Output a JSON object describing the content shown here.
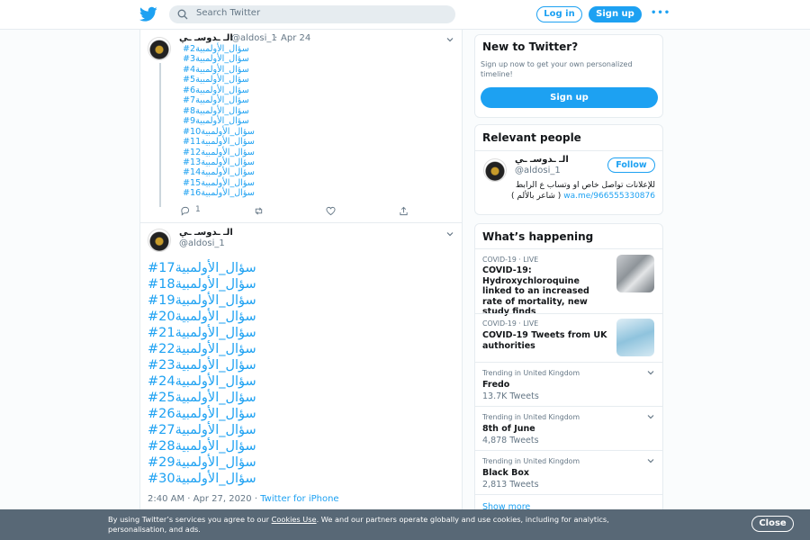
{
  "header": {
    "search_placeholder": "Search Twitter",
    "login_label": "Log in",
    "signup_label": "Sign up",
    "more_label": "•••",
    "brand_color": "#1da1f2"
  },
  "tweet1": {
    "name": "الـ ـدوسـ ـي",
    "handle": "@aldosi_1",
    "separator": "·",
    "date": "Apr 24",
    "lines": [
      "#سؤال_الأولمبية2",
      "#سؤال_الأولمبية3",
      "#سؤال_الأولمبية4",
      "#سؤال_الأولمبية5",
      "#سؤال_الأولمبية6",
      "#سؤال_الأولمبية7",
      "#سؤال_الأولمبية8",
      "#سؤال_الأولمبية9",
      "#سؤال_الأولمبية10",
      "#سؤال_الأولمبية11",
      "#سؤال_الأولمبية12",
      "#سؤال_الأولمبية13",
      "#سؤال_الأولمبية14",
      "#سؤال_الأولمبية15",
      "#سؤال_الأولمبية16"
    ],
    "reply_count": "1"
  },
  "tweet2": {
    "name": "الـ ـدوسـ ـي",
    "handle": "@aldosi_1",
    "lines": [
      "#سؤال_الأولمبية17",
      "#سؤال_الأولمبية18",
      "#سؤال_الأولمبية19",
      "#سؤال_الأولمبية20",
      "#سؤال_الأولمبية21",
      "#سؤال_الأولمبية22",
      "#سؤال_الأولمبية23",
      "#سؤال_الأولمبية24",
      "#سؤال_الأولمبية25",
      "#سؤال_الأولمبية26",
      "#سؤال_الأولمبية27",
      "#سؤال_الأولمبية28",
      "#سؤال_الأولمبية29",
      "#سؤال_الأولمبية30"
    ],
    "time": "2:40 AM · Apr 27, 2020 ·",
    "source": "Twitter for iPhone"
  },
  "new_to_twitter": {
    "title": "New to Twitter?",
    "subtitle": "Sign up now to get your own personalized timeline!",
    "button": "Sign up"
  },
  "relevant": {
    "title": "Relevant people",
    "name": "الـ ـدوسـ ـي",
    "handle": "@aldosi_1",
    "follow": "Follow",
    "bio_text": "للإعلانات تواصل خاص او وتساب ع الرابط",
    "bio_link": "wa.me/966555330876",
    "bio_end": "( شاعر بالألم )"
  },
  "happening": {
    "title": "What’s happening",
    "items": [
      {
        "meta": "COVID-19 · LIVE",
        "title": "COVID-19: Hydroxychloroquine linked to an increased rate of mortality, new study finds",
        "count": ""
      },
      {
        "meta": "COVID-19 · LIVE",
        "title": "COVID-19 Tweets from UK authorities",
        "count": ""
      },
      {
        "meta": "Trending in United Kingdom",
        "title": "Fredo",
        "count": "13.7K Tweets"
      },
      {
        "meta": "Trending in United Kingdom",
        "title": "8th of June",
        "count": "4,878 Tweets"
      },
      {
        "meta": "Trending in United Kingdom",
        "title": "Black Box",
        "count": "2,813 Tweets"
      }
    ],
    "show_more": "Show more"
  },
  "cookie": {
    "text_before": "By using Twitter’s services you agree to our",
    "link": "Cookies Use",
    "text_after": ". We and our partners operate globally and use cookies, including for analytics, personalisation, and ads.",
    "close": "Close"
  }
}
